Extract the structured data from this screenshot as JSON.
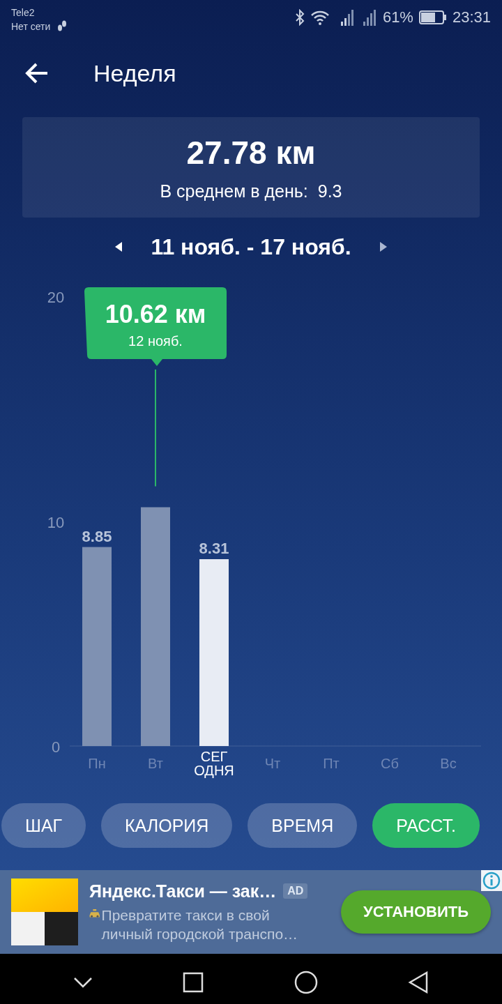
{
  "status_bar": {
    "carrier": "Tele2",
    "network": "Нет сети",
    "battery": "61%",
    "time": "23:31"
  },
  "toolbar": {
    "title": "Неделя"
  },
  "summary": {
    "total": "27.78 км",
    "average_label": "В среднем в день:",
    "average_value": "9.3"
  },
  "period": {
    "label": "11 нояб. - 17 нояб."
  },
  "chart_data": {
    "type": "bar",
    "categories": [
      "Пн",
      "Вт",
      "СЕГ\nОДНЯ",
      "Чт",
      "Пт",
      "Сб",
      "Вс"
    ],
    "ylim": [
      0,
      20
    ],
    "yticks": [
      0,
      10,
      20
    ],
    "stacked": true,
    "series": [
      {
        "color": "#7f91b2",
        "values": [
          8.85,
          10.62,
          null,
          null,
          null,
          null,
          null
        ]
      },
      {
        "color": "#e8ecf4",
        "values": [
          null,
          null,
          8.31,
          null,
          null,
          null,
          null
        ]
      }
    ],
    "value_labels": [
      "8.85",
      null,
      "8.31",
      null,
      null,
      null,
      null
    ]
  },
  "days": [
    {
      "selected": false
    },
    {
      "selected": true
    },
    {
      "selected": false
    },
    {
      "selected": false
    },
    {
      "selected": false
    },
    {
      "selected": false
    },
    {
      "selected": false
    }
  ],
  "tooltip": {
    "value": "10.62 км",
    "date": "12 нояб."
  },
  "metric_tabs": [
    {
      "label": "ШАГ",
      "selected": false
    },
    {
      "label": "КАЛОРИЯ",
      "selected": false
    },
    {
      "label": "ВРЕМЯ",
      "selected": false
    },
    {
      "label": "РАССТ.",
      "selected": true
    }
  ],
  "ad": {
    "title": "Яндекс.Такси — зак…",
    "badge": "AD",
    "text": "Превратите такси в свой личный городской транспо…",
    "button": "УСТАНОВИТЬ"
  }
}
